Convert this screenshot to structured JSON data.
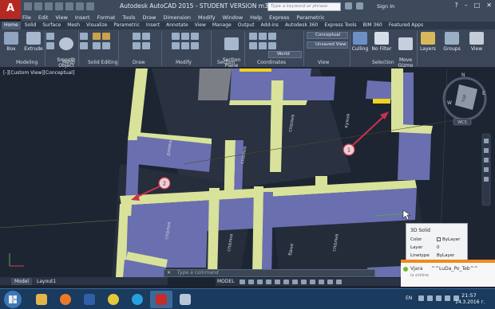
{
  "titlebar": {
    "window_title": "Autodesk AutoCAD 2015 - STUDENT VERSION     m3-v10-house.dwg",
    "search_placeholder": "Type a keyword or phrase",
    "sign_in": "Sign In",
    "app_letter": "A"
  },
  "menu": [
    "File",
    "Edit",
    "View",
    "Insert",
    "Format",
    "Tools",
    "Draw",
    "Dimension",
    "Modify",
    "Window",
    "Help",
    "Express",
    "Parametric"
  ],
  "ribbon_tabs": [
    "Home",
    "Solid",
    "Surface",
    "Mesh",
    "Visualize",
    "Parametric",
    "Insert",
    "Annotate",
    "View",
    "Manage",
    "Output",
    "Add-ins",
    "Autodesk 360",
    "Express Tools",
    "BIM 360",
    "Featured Apps"
  ],
  "ribbon": {
    "buttons": {
      "box": "Box",
      "extrude": "Extrude",
      "smooth_object": "Smooth\nObject",
      "section_plane": "Section\nPlane",
      "culling": "Culling",
      "no_filter": "No Filter",
      "move_gizmo": "Move\nGizmo",
      "layers": "Layers",
      "groups": "Groups",
      "view": "View"
    },
    "combos": {
      "visual_style": "Conceptual",
      "saved_view": "Unsaved View",
      "ucs": "World"
    },
    "panels": [
      "Modeling",
      "Mesh",
      "Solid Editing",
      "Draw",
      "Modify",
      "Section",
      "Coordinates",
      "View",
      "Selection"
    ]
  },
  "viewport": {
    "label": "[-][Custom View][Conceptual]",
    "room_labels": [
      "дневна",
      "спалня",
      "спалня",
      "спалня",
      "спалня",
      "спалня",
      "баня",
      "кухня"
    ],
    "callouts": [
      "1",
      "2"
    ],
    "viewcube": {
      "north": "N",
      "west": "W",
      "east": "E",
      "top": "TOP",
      "wcs": "WCS"
    }
  },
  "properties_tooltip": {
    "title": "3D Solid",
    "rows": [
      {
        "key": "Color",
        "value": "ByLayer"
      },
      {
        "key": "Layer",
        "value": "0"
      },
      {
        "key": "Linetype",
        "value": "ByLayer"
      }
    ]
  },
  "notification": {
    "name": "Vjara",
    "user": "^^LuDa_Po_Teb^^",
    "status": "is online"
  },
  "bottom": {
    "tabs": [
      "Model",
      "Layout1"
    ],
    "command_placeholder": "Type a command",
    "model_button": "MODEL"
  },
  "taskbar": {
    "language": "EN",
    "time": "21:57",
    "date": "14.3.2016 г."
  },
  "colors": {
    "title_bg": "#3d4a5c",
    "ribbon_bg": "#3b4759",
    "viewport_bg": "#1d2533",
    "wall_yellow": "#d8e29a",
    "wall_blue": "#6a6fb0",
    "callout_red": "#c9334a",
    "notify_orange": "#f08a1c"
  }
}
